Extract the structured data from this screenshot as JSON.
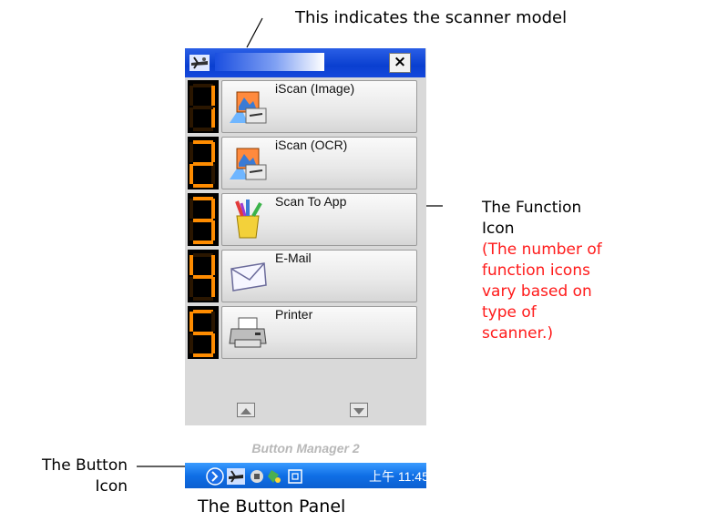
{
  "annotations": {
    "model": "This indicates the scanner model",
    "function_icon_lines": [
      "The Function",
      "Icon"
    ],
    "function_icon_note_lines": [
      "(The number of",
      "function icons",
      "vary based on",
      "type of",
      "scanner.)"
    ],
    "button_icon_lines": [
      "The Button",
      "Icon"
    ],
    "caption": "The Button Panel"
  },
  "titlebar": {
    "close_label": "×"
  },
  "functions": [
    {
      "digit": "1",
      "label": "iScan (Image)",
      "icon": "iscan-image-icon"
    },
    {
      "digit": "2",
      "label": "iScan (OCR)",
      "icon": "iscan-ocr-icon"
    },
    {
      "digit": "3",
      "label": "Scan To App",
      "icon": "scan-to-app-icon"
    },
    {
      "digit": "4",
      "label": "E-Mail",
      "icon": "email-icon"
    },
    {
      "digit": "5",
      "label": "Printer",
      "icon": "printer-icon"
    }
  ],
  "panel": {
    "name": "Button Manager 2"
  },
  "taskbar": {
    "time": "上午 11:45"
  },
  "colors": {
    "digit": "#ff8c00",
    "titlebar": "#0a3fd0",
    "taskbar": "#0f6fe6",
    "note": "#ff1a1a"
  }
}
